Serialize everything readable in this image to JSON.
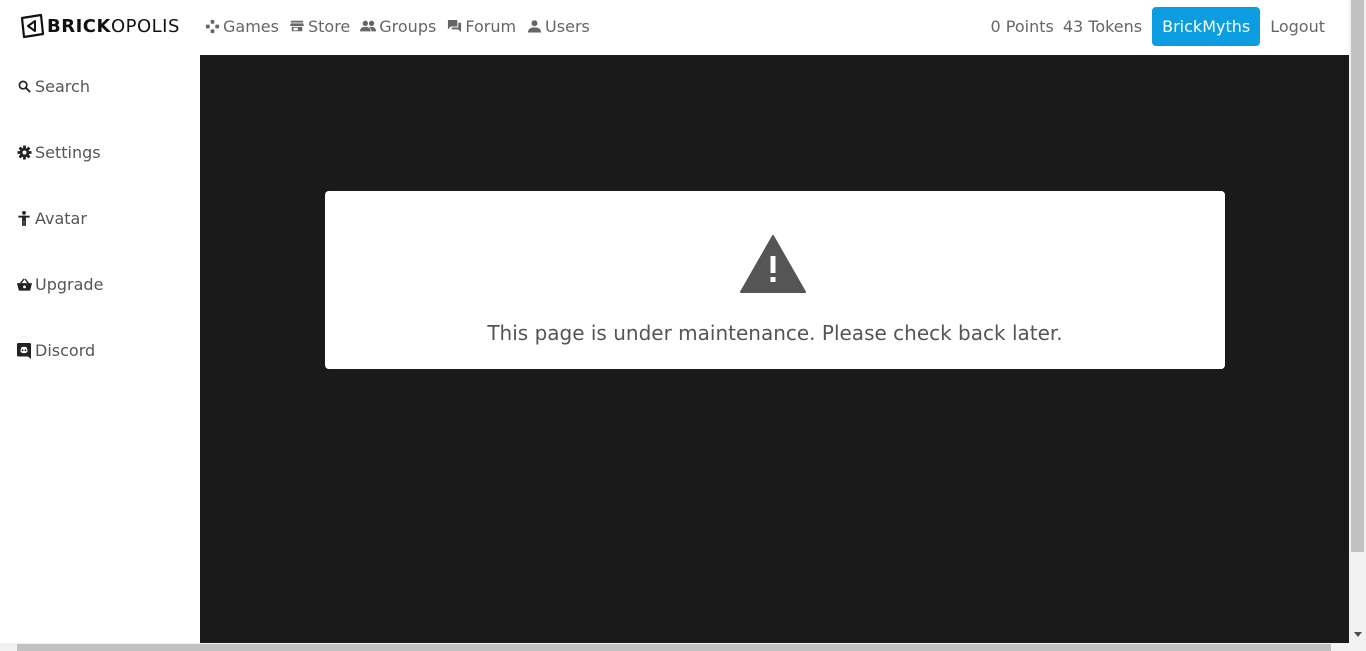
{
  "brand": {
    "logo_bold": "BRICK",
    "logo_light": "OPOLIS"
  },
  "nav": {
    "links": [
      {
        "label": "Games",
        "icon": "gamepad-icon"
      },
      {
        "label": "Store",
        "icon": "store-icon"
      },
      {
        "label": "Groups",
        "icon": "groups-icon"
      },
      {
        "label": "Forum",
        "icon": "forum-icon"
      },
      {
        "label": "Users",
        "icon": "user-icon"
      }
    ],
    "points": "0 Points",
    "tokens": "43 Tokens",
    "username": "BrickMyths",
    "logout": "Logout",
    "accent_color": "#0c9de0"
  },
  "sidebar": {
    "items": [
      {
        "label": "Search",
        "icon": "search-icon"
      },
      {
        "label": "Settings",
        "icon": "gear-icon"
      },
      {
        "label": "Avatar",
        "icon": "avatar-icon"
      },
      {
        "label": "Upgrade",
        "icon": "basket-icon"
      },
      {
        "label": "Discord",
        "icon": "discord-icon"
      }
    ]
  },
  "main": {
    "background": "#1a1a1a",
    "message": "This page is under maintenance. Please check back later.",
    "icon": "warning-icon"
  }
}
